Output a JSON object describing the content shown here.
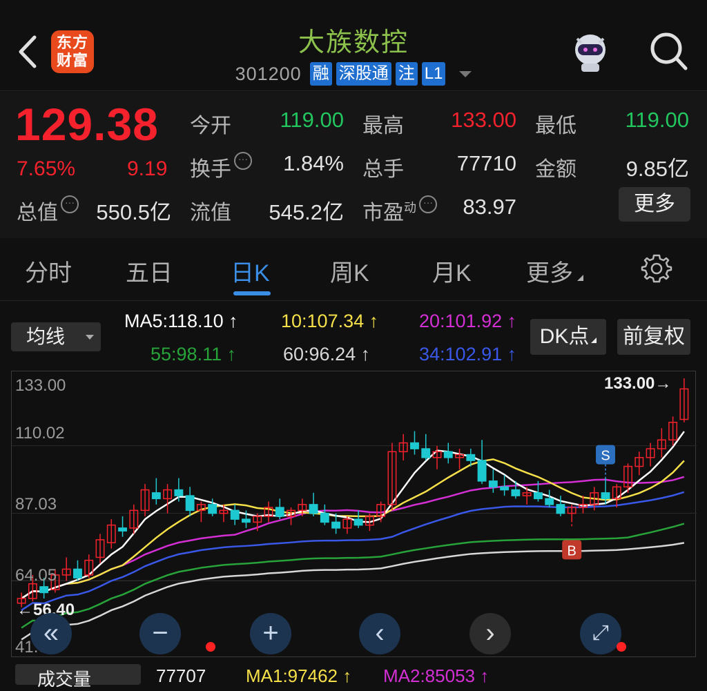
{
  "header": {
    "back_icon": "chevron-left-icon",
    "logo_text_1": "东方",
    "logo_text_2": "财富",
    "title": "大族数控",
    "code": "301200",
    "tags": [
      "融",
      "深股通",
      "注",
      "L1"
    ]
  },
  "quote": {
    "price": "129.38",
    "change_pct": "7.65%",
    "change_amt": "9.19",
    "rows": [
      {
        "l1": "今开",
        "v1": "119.00",
        "l2": "最高",
        "v2": "133.00",
        "l3": "最低",
        "v3": "119.00"
      },
      {
        "l1": "换手",
        "v1": "1.84%",
        "l2": "总手",
        "v2": "77710",
        "l3": "金额",
        "v3": "9.85亿"
      },
      {
        "l1": "总值",
        "v1": "550.5亿",
        "l2": "流值",
        "v2": "545.2亿",
        "l3": "市盈",
        "l3sup": "动",
        "v3": "83.97"
      }
    ],
    "more": "更多",
    "colors": {
      "up": "#f5222d",
      "down": "#22c55e"
    }
  },
  "tabs": {
    "items": [
      "分时",
      "五日",
      "日K",
      "周K",
      "月K",
      "更多"
    ],
    "active": "日K"
  },
  "indicators": {
    "selector": "均线",
    "ma5": "MA5:118.10 ↑",
    "ma10": "10:107.34 ↑",
    "ma20": "20:101.92 ↑",
    "ma55": "55:98.11 ↑",
    "ma60": "60:96.24 ↑",
    "ma34": "34:102.91 ↑",
    "dk_button": "DK点",
    "adjust_button": "前复权",
    "colors": {
      "ma5": "#ffffff",
      "ma10": "#f5e04a",
      "ma20": "#d42fd4",
      "ma55": "#27a33a",
      "ma60": "#d8d8d8",
      "ma34": "#3a58e8"
    }
  },
  "chart_data": {
    "type": "candlestick",
    "ylim": [
      41.06,
      133.0
    ],
    "y_ticks": [
      "133.00",
      "110.02",
      "87.03",
      "64.05",
      "41.06"
    ],
    "high_label": "133.00→",
    "low_label": "←56.40",
    "signals": [
      {
        "label": "S",
        "index": 52
      },
      {
        "label": "B",
        "index": 49
      }
    ],
    "ohlc": [
      [
        56.4,
        60,
        55,
        58
      ],
      [
        58,
        66,
        57,
        63
      ],
      [
        62,
        65,
        58,
        60
      ],
      [
        61,
        68,
        60,
        66
      ],
      [
        66,
        72,
        64,
        68
      ],
      [
        68,
        71,
        64,
        65
      ],
      [
        66,
        73,
        65,
        71
      ],
      [
        72,
        80,
        70,
        78
      ],
      [
        77,
        85,
        75,
        83
      ],
      [
        82,
        86,
        79,
        81
      ],
      [
        82,
        90,
        80,
        88
      ],
      [
        88,
        97,
        86,
        95
      ],
      [
        94,
        99,
        90,
        92
      ],
      [
        92,
        97,
        87,
        95
      ],
      [
        95,
        99,
        91,
        93
      ],
      [
        93,
        96,
        86,
        88
      ],
      [
        88,
        91,
        84,
        90
      ],
      [
        90,
        92,
        86,
        87
      ],
      [
        87,
        90,
        84,
        88
      ],
      [
        88,
        90,
        83,
        85
      ],
      [
        85,
        88,
        82,
        84
      ],
      [
        84,
        87,
        81,
        86
      ],
      [
        86,
        91,
        84,
        89
      ],
      [
        89,
        92,
        85,
        86
      ],
      [
        86,
        89,
        83,
        88
      ],
      [
        88,
        92,
        86,
        90
      ],
      [
        90,
        94,
        86,
        87
      ],
      [
        87,
        90,
        83,
        84
      ],
      [
        84,
        87,
        80,
        82
      ],
      [
        82,
        86,
        80,
        85
      ],
      [
        85,
        88,
        82,
        83
      ],
      [
        83,
        87,
        81,
        86
      ],
      [
        86,
        91,
        84,
        90
      ],
      [
        90,
        111,
        88,
        108
      ],
      [
        108,
        114,
        105,
        111
      ],
      [
        111,
        115,
        107,
        109
      ],
      [
        109,
        114,
        105,
        106
      ],
      [
        106,
        110,
        102,
        108
      ],
      [
        108,
        111,
        104,
        106
      ],
      [
        106,
        109,
        102,
        107
      ],
      [
        107,
        109,
        103,
        105
      ],
      [
        105,
        112,
        97,
        98
      ],
      [
        98,
        102,
        94,
        96
      ],
      [
        96,
        100,
        93,
        95
      ],
      [
        95,
        98,
        92,
        93
      ],
      [
        93,
        96,
        90,
        94
      ],
      [
        94,
        98,
        91,
        92
      ],
      [
        92,
        95,
        89,
        90
      ],
      [
        90,
        93,
        86,
        87
      ],
      [
        87,
        90,
        84,
        89
      ],
      [
        89,
        93,
        87,
        90
      ],
      [
        90,
        96,
        88,
        94
      ],
      [
        94,
        99,
        90,
        92
      ],
      [
        92,
        97,
        89,
        96
      ],
      [
        96,
        104,
        94,
        103
      ],
      [
        103,
        108,
        100,
        106
      ],
      [
        106,
        111,
        103,
        109
      ],
      [
        109,
        116,
        106,
        112
      ],
      [
        112,
        120,
        110,
        118
      ],
      [
        119,
        133,
        118,
        129.38
      ]
    ]
  },
  "controls": [
    "double-chevron-left-icon",
    "minus-icon",
    "plus-icon",
    "chevron-left-icon",
    "chevron-right-icon",
    "expand-icon"
  ],
  "volume_bar": {
    "selector": "成交量",
    "value": "77707",
    "ma1": "MA1:97462 ↑",
    "ma2": "MA2:85053 ↑"
  }
}
